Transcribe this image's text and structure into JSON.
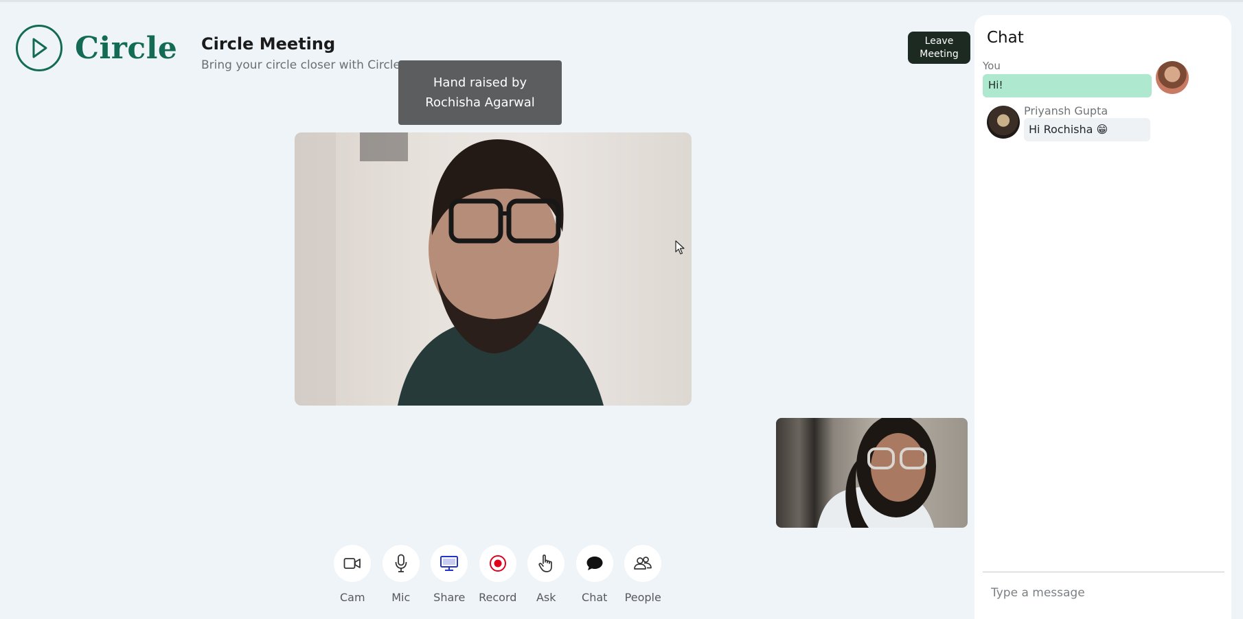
{
  "brand": {
    "name": "Circle",
    "logo_icon": "play-icon",
    "color": "#136b55"
  },
  "meeting": {
    "title": "Circle Meeting",
    "subtitle": "Bring your circle closer with Circle"
  },
  "header": {
    "leave_label": "Leave Meeting"
  },
  "toast": {
    "text": "Hand raised by Rochisha Agarwal"
  },
  "toolbar": {
    "items": [
      {
        "label": "Cam",
        "icon": "camera-icon"
      },
      {
        "label": "Mic",
        "icon": "mic-icon"
      },
      {
        "label": "Share",
        "icon": "monitor-icon"
      },
      {
        "label": "Record",
        "icon": "record-icon"
      },
      {
        "label": "Ask",
        "icon": "hand-icon"
      },
      {
        "label": "Chat",
        "icon": "chat-bubble-icon"
      },
      {
        "label": "People",
        "icon": "people-icon"
      }
    ]
  },
  "chat": {
    "title": "Chat",
    "messages": [
      {
        "sender": "You",
        "text": "Hi!"
      },
      {
        "sender": "Priyansh Gupta",
        "text": "Hi Rochisha 😁"
      }
    ],
    "input_placeholder": "Type a message"
  },
  "colors": {
    "background": "#eff4f8",
    "accent": "#136b55",
    "own_bubble": "#aee8cf",
    "leave_button": "#1c2a22",
    "record": "#e0001b",
    "share": "#2233cc"
  }
}
